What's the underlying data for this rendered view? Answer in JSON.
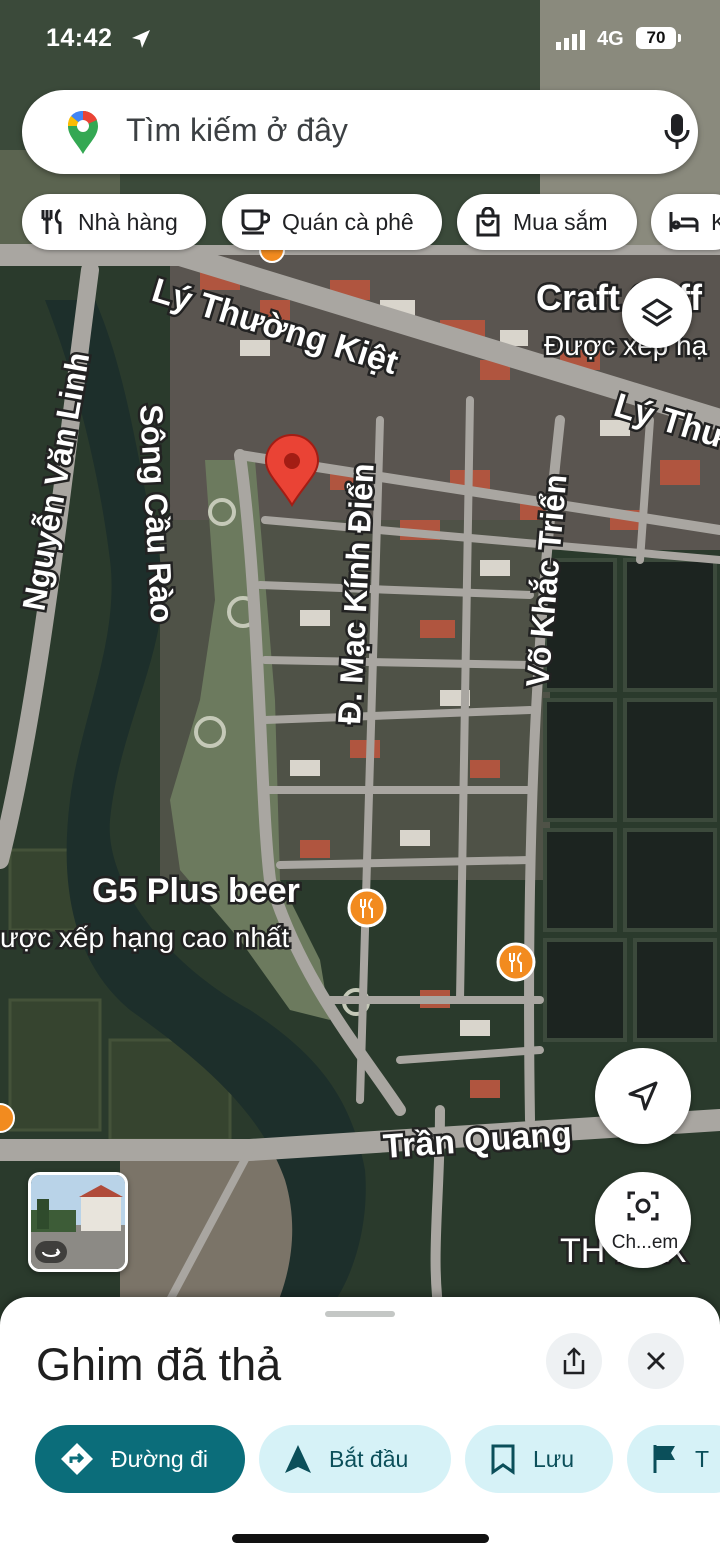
{
  "status_bar": {
    "time": "14:42",
    "network": "4G",
    "battery": "70"
  },
  "search": {
    "placeholder": "Tìm kiếm ở đây"
  },
  "chips": [
    {
      "label": "Nhà hàng",
      "icon": "restaurant-icon"
    },
    {
      "label": "Quán cà phê",
      "icon": "coffee-icon"
    },
    {
      "label": "Mua sắm",
      "icon": "shopping-bag-icon"
    },
    {
      "label": "K",
      "icon": "hotel-icon"
    }
  ],
  "map": {
    "streets": {
      "ly_thuong_kiet": "Lý Thường Kiệt",
      "ly_thuong_kiet_2": "Lý Thư",
      "nguyen_van_linh": "Nguyễn Văn Linh",
      "song_cau_rao": "Sông Cầu Rào",
      "mac_kinh_dien": "Đ. Mạc Kính Điển",
      "vo_khac_trien": "Võ Khắc Triển",
      "tran_quang": "Trần Quang "
    },
    "places": {
      "craft": "Craft Coff",
      "craft_rating": "Được xếp hạ",
      "g5": "G5 Plus beer",
      "g5_rating": "ược xếp hạng cao nhất",
      "thbox": "TH BOX"
    },
    "lens_label": "Ch...em"
  },
  "sheet": {
    "title": "Ghim đã thả",
    "actions": [
      {
        "label": "Đường đi"
      },
      {
        "label": "Bắt đầu"
      },
      {
        "label": "Lưu"
      },
      {
        "label": "T"
      }
    ]
  },
  "colors": {
    "accent": "#0b6d7a",
    "secondary_bg": "#d6f2f7",
    "pin": "#ea4335",
    "poi": "#f28b1f"
  }
}
